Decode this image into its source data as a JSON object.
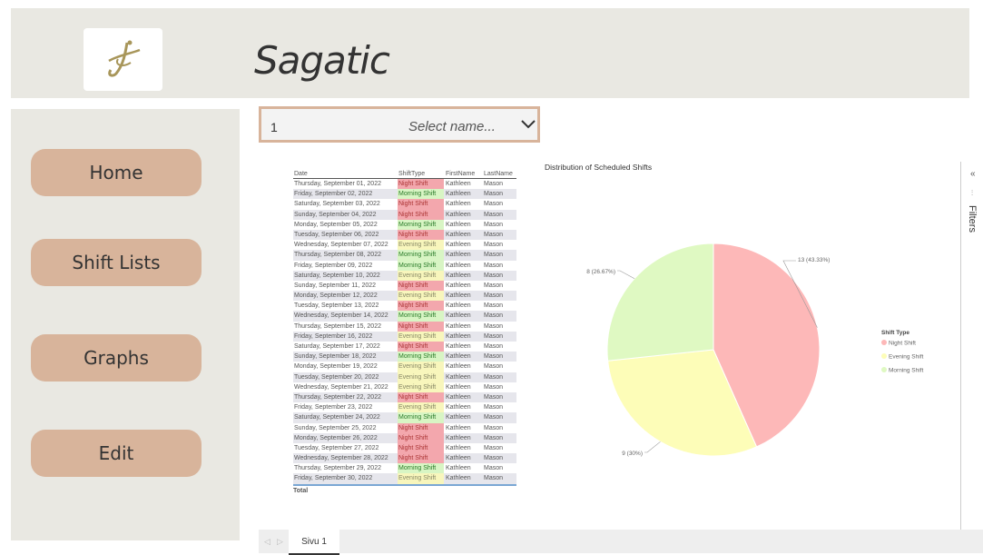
{
  "header": {
    "title": "Sagatic"
  },
  "sidebar": {
    "items": [
      {
        "label": "Home"
      },
      {
        "label": "Shift Lists"
      },
      {
        "label": "Graphs"
      },
      {
        "label": "Edit"
      }
    ]
  },
  "selector": {
    "value": "1",
    "placeholder": "Select name..."
  },
  "table": {
    "headers": [
      "Date",
      "ShiftType",
      "FirstName",
      "LastName"
    ],
    "rows": [
      {
        "date": "Thursday, September 01, 2022",
        "shift": "Night Shift",
        "first": "Kathleen",
        "last": "Mason"
      },
      {
        "date": "Friday, September 02, 2022",
        "shift": "Morning Shift",
        "first": "Kathleen",
        "last": "Mason"
      },
      {
        "date": "Saturday, September 03, 2022",
        "shift": "Night Shift",
        "first": "Kathleen",
        "last": "Mason"
      },
      {
        "date": "Sunday, September 04, 2022",
        "shift": "Night Shift",
        "first": "Kathleen",
        "last": "Mason"
      },
      {
        "date": "Monday, September 05, 2022",
        "shift": "Morning Shift",
        "first": "Kathleen",
        "last": "Mason"
      },
      {
        "date": "Tuesday, September 06, 2022",
        "shift": "Night Shift",
        "first": "Kathleen",
        "last": "Mason"
      },
      {
        "date": "Wednesday, September 07, 2022",
        "shift": "Evening Shift",
        "first": "Kathleen",
        "last": "Mason"
      },
      {
        "date": "Thursday, September 08, 2022",
        "shift": "Morning Shift",
        "first": "Kathleen",
        "last": "Mason"
      },
      {
        "date": "Friday, September 09, 2022",
        "shift": "Morning Shift",
        "first": "Kathleen",
        "last": "Mason"
      },
      {
        "date": "Saturday, September 10, 2022",
        "shift": "Evening Shift",
        "first": "Kathleen",
        "last": "Mason"
      },
      {
        "date": "Sunday, September 11, 2022",
        "shift": "Night Shift",
        "first": "Kathleen",
        "last": "Mason"
      },
      {
        "date": "Monday, September 12, 2022",
        "shift": "Evening Shift",
        "first": "Kathleen",
        "last": "Mason"
      },
      {
        "date": "Tuesday, September 13, 2022",
        "shift": "Night Shift",
        "first": "Kathleen",
        "last": "Mason"
      },
      {
        "date": "Wednesday, September 14, 2022",
        "shift": "Morning Shift",
        "first": "Kathleen",
        "last": "Mason"
      },
      {
        "date": "Thursday, September 15, 2022",
        "shift": "Night Shift",
        "first": "Kathleen",
        "last": "Mason"
      },
      {
        "date": "Friday, September 16, 2022",
        "shift": "Evening Shift",
        "first": "Kathleen",
        "last": "Mason"
      },
      {
        "date": "Saturday, September 17, 2022",
        "shift": "Night Shift",
        "first": "Kathleen",
        "last": "Mason"
      },
      {
        "date": "Sunday, September 18, 2022",
        "shift": "Morning Shift",
        "first": "Kathleen",
        "last": "Mason"
      },
      {
        "date": "Monday, September 19, 2022",
        "shift": "Evening Shift",
        "first": "Kathleen",
        "last": "Mason"
      },
      {
        "date": "Tuesday, September 20, 2022",
        "shift": "Evening Shift",
        "first": "Kathleen",
        "last": "Mason"
      },
      {
        "date": "Wednesday, September 21, 2022",
        "shift": "Evening Shift",
        "first": "Kathleen",
        "last": "Mason"
      },
      {
        "date": "Thursday, September 22, 2022",
        "shift": "Night Shift",
        "first": "Kathleen",
        "last": "Mason"
      },
      {
        "date": "Friday, September 23, 2022",
        "shift": "Evening Shift",
        "first": "Kathleen",
        "last": "Mason"
      },
      {
        "date": "Saturday, September 24, 2022",
        "shift": "Morning Shift",
        "first": "Kathleen",
        "last": "Mason"
      },
      {
        "date": "Sunday, September 25, 2022",
        "shift": "Night Shift",
        "first": "Kathleen",
        "last": "Mason"
      },
      {
        "date": "Monday, September 26, 2022",
        "shift": "Night Shift",
        "first": "Kathleen",
        "last": "Mason"
      },
      {
        "date": "Tuesday, September 27, 2022",
        "shift": "Night Shift",
        "first": "Kathleen",
        "last": "Mason"
      },
      {
        "date": "Wednesday, September 28, 2022",
        "shift": "Night Shift",
        "first": "Kathleen",
        "last": "Mason"
      },
      {
        "date": "Thursday, September 29, 2022",
        "shift": "Morning Shift",
        "first": "Kathleen",
        "last": "Mason"
      },
      {
        "date": "Friday, September 30, 2022",
        "shift": "Evening Shift",
        "first": "Kathleen",
        "last": "Mason"
      }
    ],
    "total_label": "Total"
  },
  "chart_data": {
    "type": "pie",
    "title": "Distribution of Scheduled Shifts",
    "legend_title": "Shift Type",
    "legend_position": "right",
    "categories": [
      "Night Shift",
      "Evening Shift",
      "Morning Shift"
    ],
    "values": [
      13,
      9,
      8
    ],
    "data_labels": [
      "13 (43.33%)",
      "9 (30%)",
      "8 (26.67%)"
    ],
    "colors": [
      "#fdb8b8",
      "#fdfdb8",
      "#dff9c2"
    ]
  },
  "filters": {
    "label": "Filters"
  },
  "tabs": {
    "page1": "Sivu 1"
  }
}
